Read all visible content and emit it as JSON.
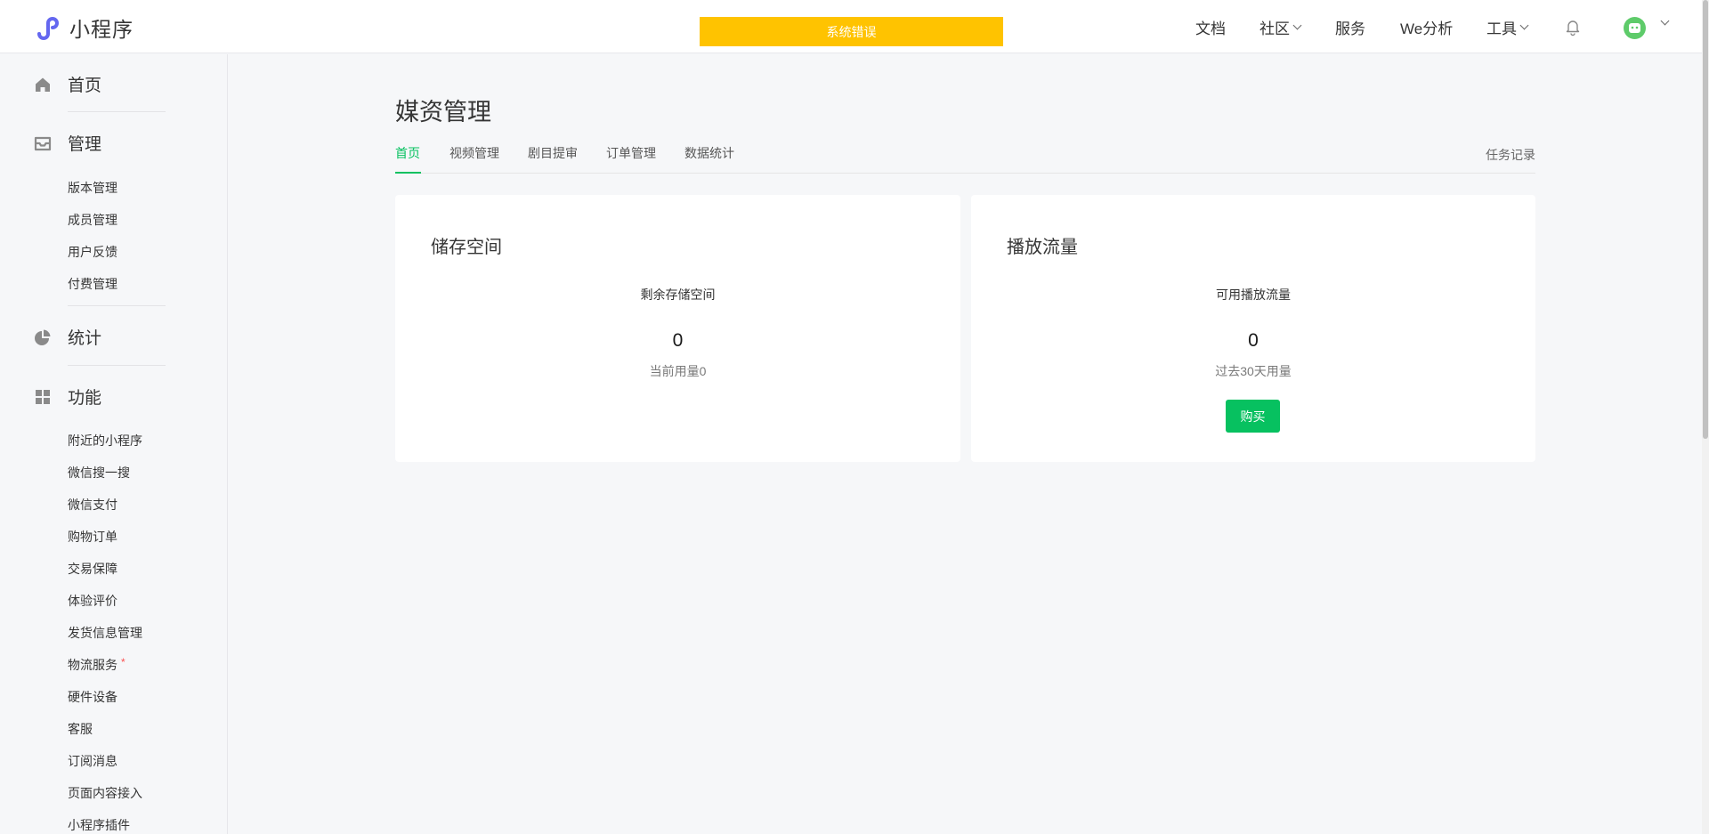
{
  "app": {
    "title": "小程序"
  },
  "banner": {
    "text": "系统错误"
  },
  "topnav": {
    "docs": "文档",
    "community": "社区",
    "service": "服务",
    "analytics": "We分析",
    "tools": "工具"
  },
  "sidebar": {
    "groups": [
      {
        "label": "首页",
        "icon": "home-icon"
      },
      {
        "label": "管理",
        "icon": "inbox-icon"
      },
      {
        "label": "统计",
        "icon": "pie-chart-icon"
      },
      {
        "label": "功能",
        "icon": "grid-icon"
      }
    ],
    "manage_items": [
      "版本管理",
      "成员管理",
      "用户反馈",
      "付费管理"
    ],
    "feature_items": [
      "附近的小程序",
      "微信搜一搜",
      "微信支付",
      "购物订单",
      "交易保障",
      "体验评价",
      "发货信息管理",
      "物流服务",
      "硬件设备",
      "客服",
      "订阅消息",
      "页面内容接入",
      "小程序插件"
    ],
    "feature_badge": "*"
  },
  "page": {
    "title": "媒资管理",
    "tabs": [
      "首页",
      "视频管理",
      "剧目提审",
      "订单管理",
      "数据统计"
    ],
    "task_record": "任务记录"
  },
  "cards": {
    "storage": {
      "title": "储存空间",
      "sub": "剩余存储空间",
      "value": "0",
      "note": "当前用量0"
    },
    "traffic": {
      "title": "播放流量",
      "sub": "可用播放流量",
      "value": "0",
      "note": "过去30天用量",
      "button": "购买"
    }
  },
  "colors": {
    "accent": "#07c160",
    "banner": "#ffc300",
    "logo": "#6467f0"
  }
}
